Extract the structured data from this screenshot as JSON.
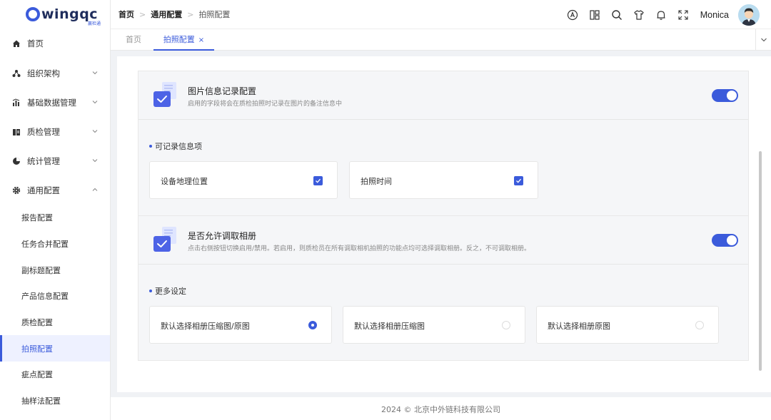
{
  "app": {
    "logo_text": "wingqc",
    "logo_sub": "赢检通"
  },
  "sidebar": {
    "items": [
      {
        "label": "首页",
        "icon": "home-icon"
      },
      {
        "label": "组织架构",
        "icon": "org-icon"
      },
      {
        "label": "基础数据管理",
        "icon": "data-icon"
      },
      {
        "label": "质检管理",
        "icon": "qc-icon"
      },
      {
        "label": "统计管理",
        "icon": "pie-icon"
      },
      {
        "label": "通用配置",
        "icon": "gear-icon"
      }
    ],
    "sub_items": [
      {
        "label": "报告配置"
      },
      {
        "label": "任务合并配置"
      },
      {
        "label": "副标题配置"
      },
      {
        "label": "产品信息配置"
      },
      {
        "label": "质检配置"
      },
      {
        "label": "拍照配置",
        "active": true
      },
      {
        "label": "疵点配置"
      },
      {
        "label": "抽样法配置"
      }
    ]
  },
  "header": {
    "breadcrumb": [
      "首页",
      "通用配置",
      "拍照配置"
    ],
    "user": "Monica",
    "icons": [
      "translate-icon",
      "layout-icon",
      "search-icon",
      "shirt-icon",
      "bell-icon",
      "fullscreen-icon"
    ]
  },
  "tabs": [
    {
      "label": "首页"
    },
    {
      "label": "拍照配置",
      "close": "×",
      "active": true
    }
  ],
  "photo_info": {
    "title": "图片信息记录配置",
    "desc": "启用的字段将会在质检拍照时记录在图片的备注信息中",
    "enabled": true,
    "section_title": "可记录信息项",
    "options": [
      {
        "label": "设备地理位置",
        "checked": true
      },
      {
        "label": "拍照时间",
        "checked": true
      }
    ]
  },
  "album": {
    "title": "是否允许调取相册",
    "desc": "点击右侧按钮切换启用/禁用。若启用，则质检员在所有调取相机拍照的功能点均可选择调取相册。反之，不可调取相册。",
    "enabled": true,
    "section_title": "更多设定",
    "options": [
      {
        "label": "默认选择相册压缩图/原图",
        "selected": true
      },
      {
        "label": "默认选择相册压缩图",
        "selected": false
      },
      {
        "label": "默认选择相册原图",
        "selected": false
      }
    ]
  },
  "footer": {
    "text": "2024 © 北京中外链科技有限公司"
  },
  "colors": {
    "accent": "#3b5bdb",
    "panel_bg": "#f5f6f8",
    "page_bg": "#f0f2f5"
  }
}
